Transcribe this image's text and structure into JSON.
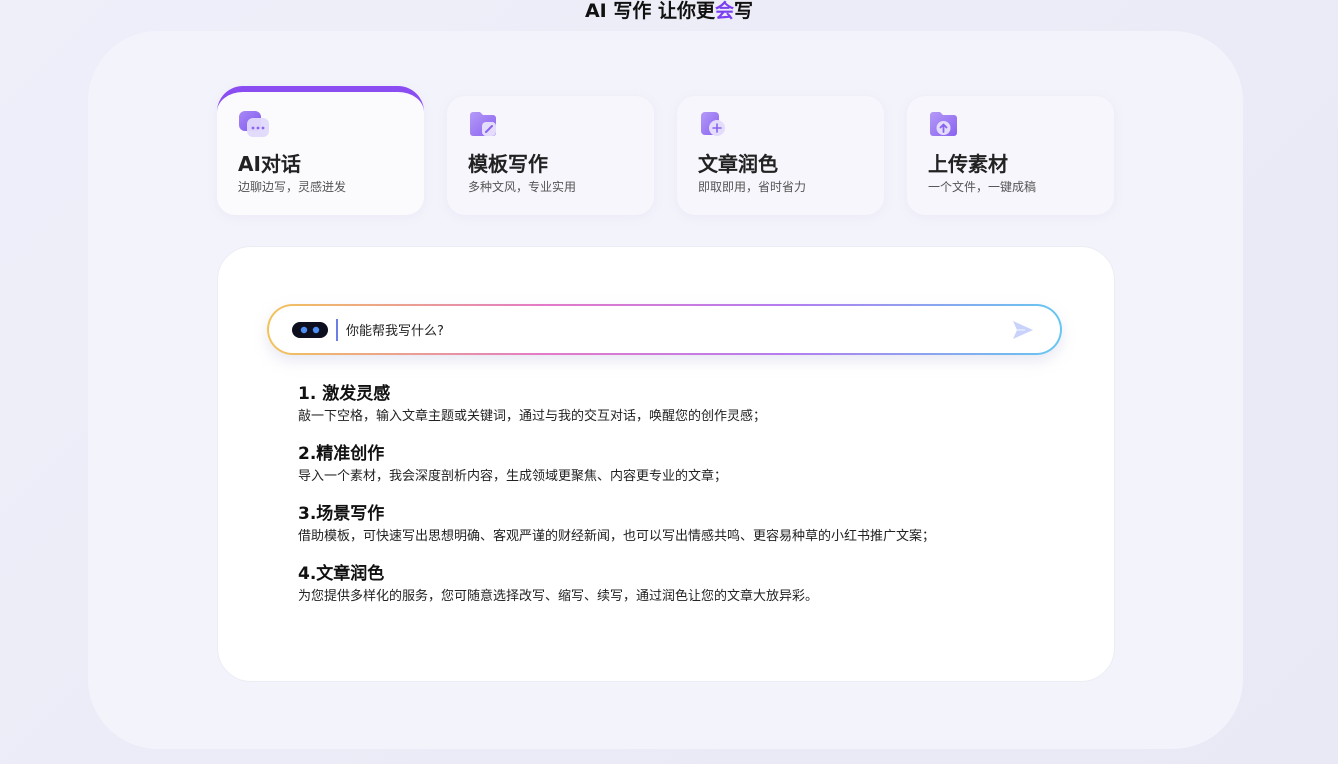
{
  "page": {
    "title_part1": "AI 写作 让你更",
    "title_accent": "会",
    "title_part2": "写",
    "accent_color": "#7b3ff2"
  },
  "modes": [
    {
      "icon": "chat-bubble-icon",
      "title": "AI对话",
      "subtitle": "边聊边写，灵感迸发",
      "active": true
    },
    {
      "icon": "template-folder-icon",
      "title": "模板写作",
      "subtitle": "多种文风，专业实用",
      "active": false
    },
    {
      "icon": "polish-document-icon",
      "title": "文章润色",
      "subtitle": "即取即用，省时省力",
      "active": false
    },
    {
      "icon": "upload-folder-icon",
      "title": "上传素材",
      "subtitle": "一个文件，一键成稿",
      "active": false
    }
  ],
  "prompt": {
    "placeholder": "你能帮我写什么?",
    "value": "",
    "assistant_icon": "robot-icon",
    "send_icon": "send-icon"
  },
  "guide": [
    {
      "title": "1. 激发灵感",
      "desc": "敲一下空格，输入文章主题或关键词，通过与我的交互对话，唤醒您的创作灵感；"
    },
    {
      "title": "2.精准创作",
      "desc": "导入一个素材，我会深度剖析内容，生成领域更聚焦、内容更专业的文章；"
    },
    {
      "title": "3.场景写作",
      "desc": "借助模板，可快速写出思想明确、客观严谨的财经新闻，也可以写出情感共鸣、更容易种草的小红书推广文案；"
    },
    {
      "title": "4.文章润色",
      "desc": "为您提供多样化的服务，您可随意选择改写、缩写、续写，通过润色让您的文章大放异彩。"
    }
  ]
}
